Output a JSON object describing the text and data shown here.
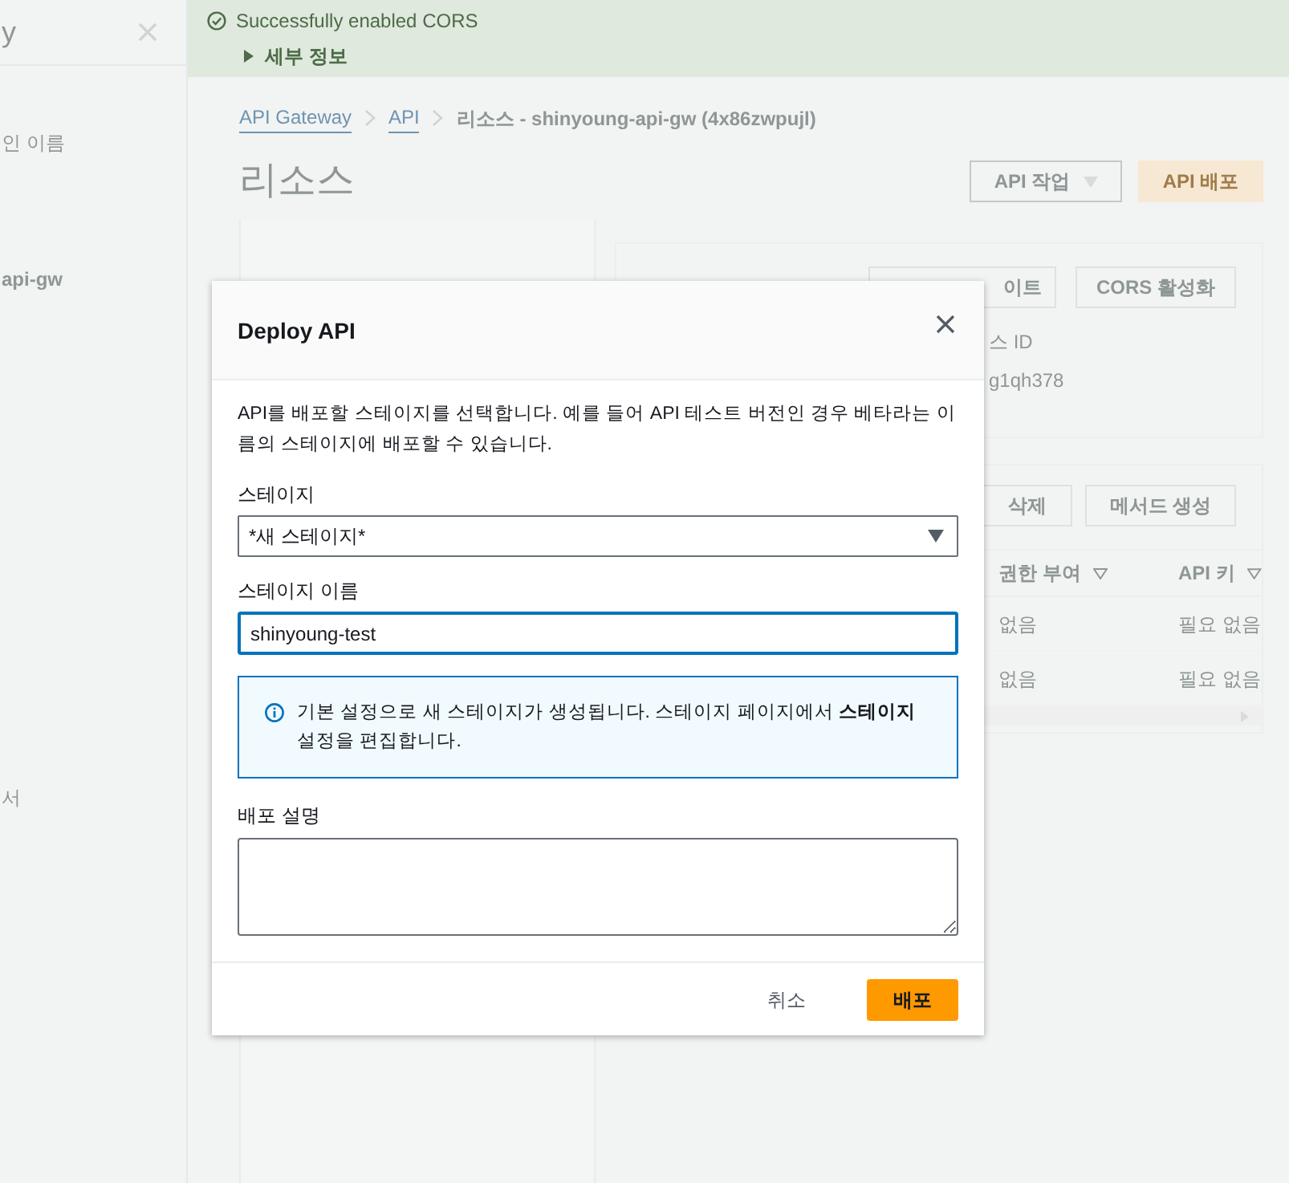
{
  "sidebar": {
    "title": "y",
    "items": [
      {
        "label": "인 이름"
      },
      {
        "label": "api-gw"
      },
      {
        "label": "서"
      }
    ]
  },
  "flash": {
    "message": "Successfully enabled CORS",
    "details": "세부 정보",
    "expanded": false
  },
  "breadcrumb": [
    {
      "label": "API Gateway",
      "kind": "link"
    },
    {
      "label": "API",
      "kind": "link"
    },
    {
      "label": "리소스 - shinyoung-api-gw (4x86zwpujl)",
      "kind": "current"
    }
  ],
  "page_title": "리소스",
  "header_buttons": [
    {
      "label": "API 작업",
      "kind": "dropdown"
    },
    {
      "label": "API 배포",
      "kind": "primary"
    }
  ],
  "resource_panel": {
    "buttons": [
      "이트",
      "CORS 활성화"
    ],
    "id_label": "스 ID",
    "id_value": "g1qh378"
  },
  "methods_panel": {
    "buttons": [
      "삭제",
      "메서드 생성"
    ],
    "columns": [
      "권한 부여",
      "API 키"
    ],
    "rows": [
      [
        "없음",
        "필요 없음"
      ],
      [
        "없음",
        "필요 없음"
      ]
    ]
  },
  "dialog": {
    "title": "Deploy API",
    "description": "API를 배포할 스테이지를 선택합니다. 예를 들어 API 테스트 버전인 경우 베타라는 이름의 스테이지에 배포할 수 있습니다.",
    "fields": [
      {
        "kind": "select",
        "label": "스테이지",
        "value": "*새 스테이지*",
        "focused": false
      },
      {
        "kind": "text",
        "label": "스테이지 이름",
        "value": "shinyoung-test",
        "focused": true
      }
    ],
    "info": "기본 설정으로 새 스테이지가 생성됩니다. 스테이지 페이지에서 **스테이지** 설정을 편집합니다.",
    "textarea_label": "배포 설명",
    "buttons": [
      {
        "label": "취소",
        "kind": "cancel"
      },
      {
        "label": "배포",
        "kind": "primary"
      }
    ]
  }
}
